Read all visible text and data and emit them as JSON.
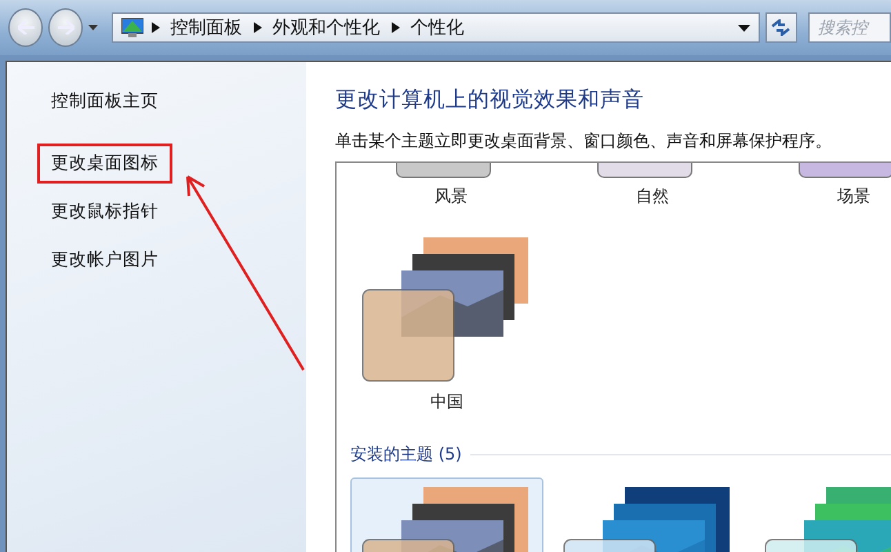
{
  "address_bar": {
    "breadcrumbs": [
      "控制面板",
      "外观和个性化",
      "个性化"
    ]
  },
  "search": {
    "placeholder": "搜索控"
  },
  "sidebar": {
    "items": [
      {
        "label": "控制面板主页",
        "highlighted": false
      },
      {
        "label": "更改桌面图标",
        "highlighted": true
      },
      {
        "label": "更改鼠标指针",
        "highlighted": false
      },
      {
        "label": "更改帐户图片",
        "highlighted": false
      }
    ]
  },
  "main": {
    "title": "更改计算机上的视觉效果和声音",
    "subtitle": "单击某个主题立即更改桌面背景、窗口颜色、声音和屏幕保护程序。",
    "partial_themes": [
      {
        "label": "风景"
      },
      {
        "label": "自然"
      },
      {
        "label": "场景"
      }
    ],
    "my_themes": [
      {
        "label": "中国",
        "selected": false
      }
    ],
    "installed_section": {
      "heading": "安装的主题 (5)",
      "themes": [
        {
          "selected": true
        },
        {
          "selected": false
        },
        {
          "selected": false
        }
      ]
    }
  }
}
